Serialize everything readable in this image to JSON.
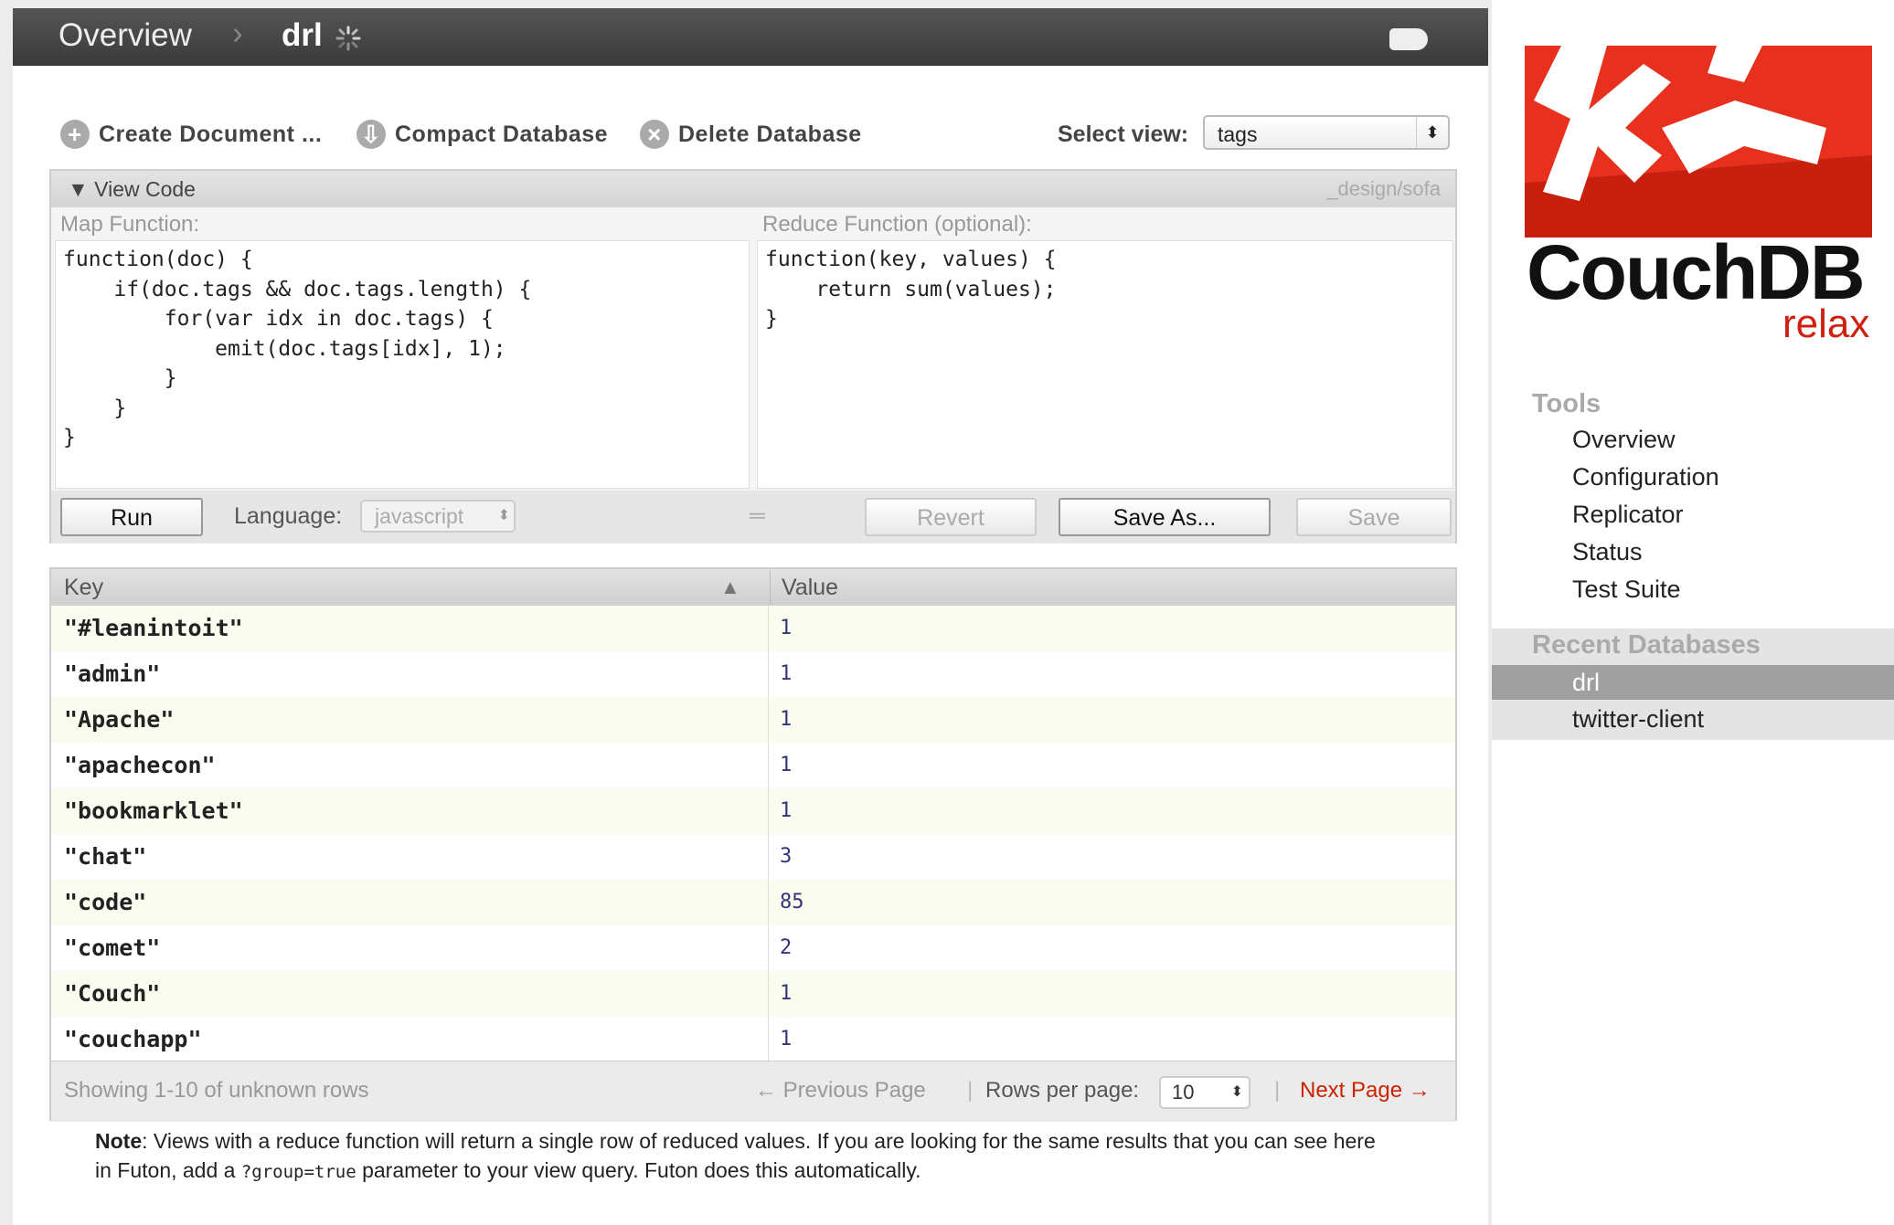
{
  "header": {
    "overview": "Overview",
    "separator": "›",
    "database": "drl"
  },
  "toolbar": {
    "create": "Create Document ...",
    "compact": "Compact Database",
    "delete": "Delete Database",
    "select_view_label": "Select view:",
    "select_view_value": "tags"
  },
  "view_code": {
    "toggle": "▼ View Code",
    "design_doc": "_design/sofa",
    "map_label": "Map Function:",
    "reduce_label": "Reduce Function (optional):",
    "map_code": "function(doc) {\n    if(doc.tags && doc.tags.length) {\n        for(var idx in doc.tags) {\n            emit(doc.tags[idx], 1);\n        }\n    }\n}",
    "reduce_code": "function(key, values) {\n    return sum(values);\n}",
    "run": "Run",
    "language_label": "Language:",
    "language_value": "javascript",
    "revert": "Revert",
    "save_as": "Save As...",
    "save": "Save"
  },
  "results": {
    "columns": [
      "Key",
      "Value"
    ],
    "rows": [
      {
        "key": "\"#leanintoit\"",
        "value": "1"
      },
      {
        "key": "\"admin\"",
        "value": "1"
      },
      {
        "key": "\"Apache\"",
        "value": "1"
      },
      {
        "key": "\"apachecon\"",
        "value": "1"
      },
      {
        "key": "\"bookmarklet\"",
        "value": "1"
      },
      {
        "key": "\"chat\"",
        "value": "3"
      },
      {
        "key": "\"code\"",
        "value": "85"
      },
      {
        "key": "\"comet\"",
        "value": "2"
      },
      {
        "key": "\"Couch\"",
        "value": "1"
      },
      {
        "key": "\"couchapp\"",
        "value": "1"
      }
    ],
    "showing": "Showing 1-10 of unknown rows",
    "prev": "← Previous Page",
    "rows_per_page_label": "Rows per page:",
    "rows_per_page": "10",
    "next": "Next Page →"
  },
  "note": {
    "label": "Note",
    "text_1": ": Views with a reduce function will return a single row of reduced values. If you are looking for the same results that you can see here in Futon, add a ",
    "code": "?group=true",
    "text_2": " parameter to your view query. Futon does this automatically."
  },
  "sidebar": {
    "logo_word": "CouchDB",
    "logo_tagline": "relax",
    "tools_heading": "Tools",
    "tools": [
      "Overview",
      "Configuration",
      "Replicator",
      "Status",
      "Test Suite"
    ],
    "recent_heading": "Recent Databases",
    "recent": [
      "drl",
      "twitter-client"
    ]
  },
  "colors": {
    "accent_red": "#e8301f",
    "next_link": "#cc2200"
  }
}
